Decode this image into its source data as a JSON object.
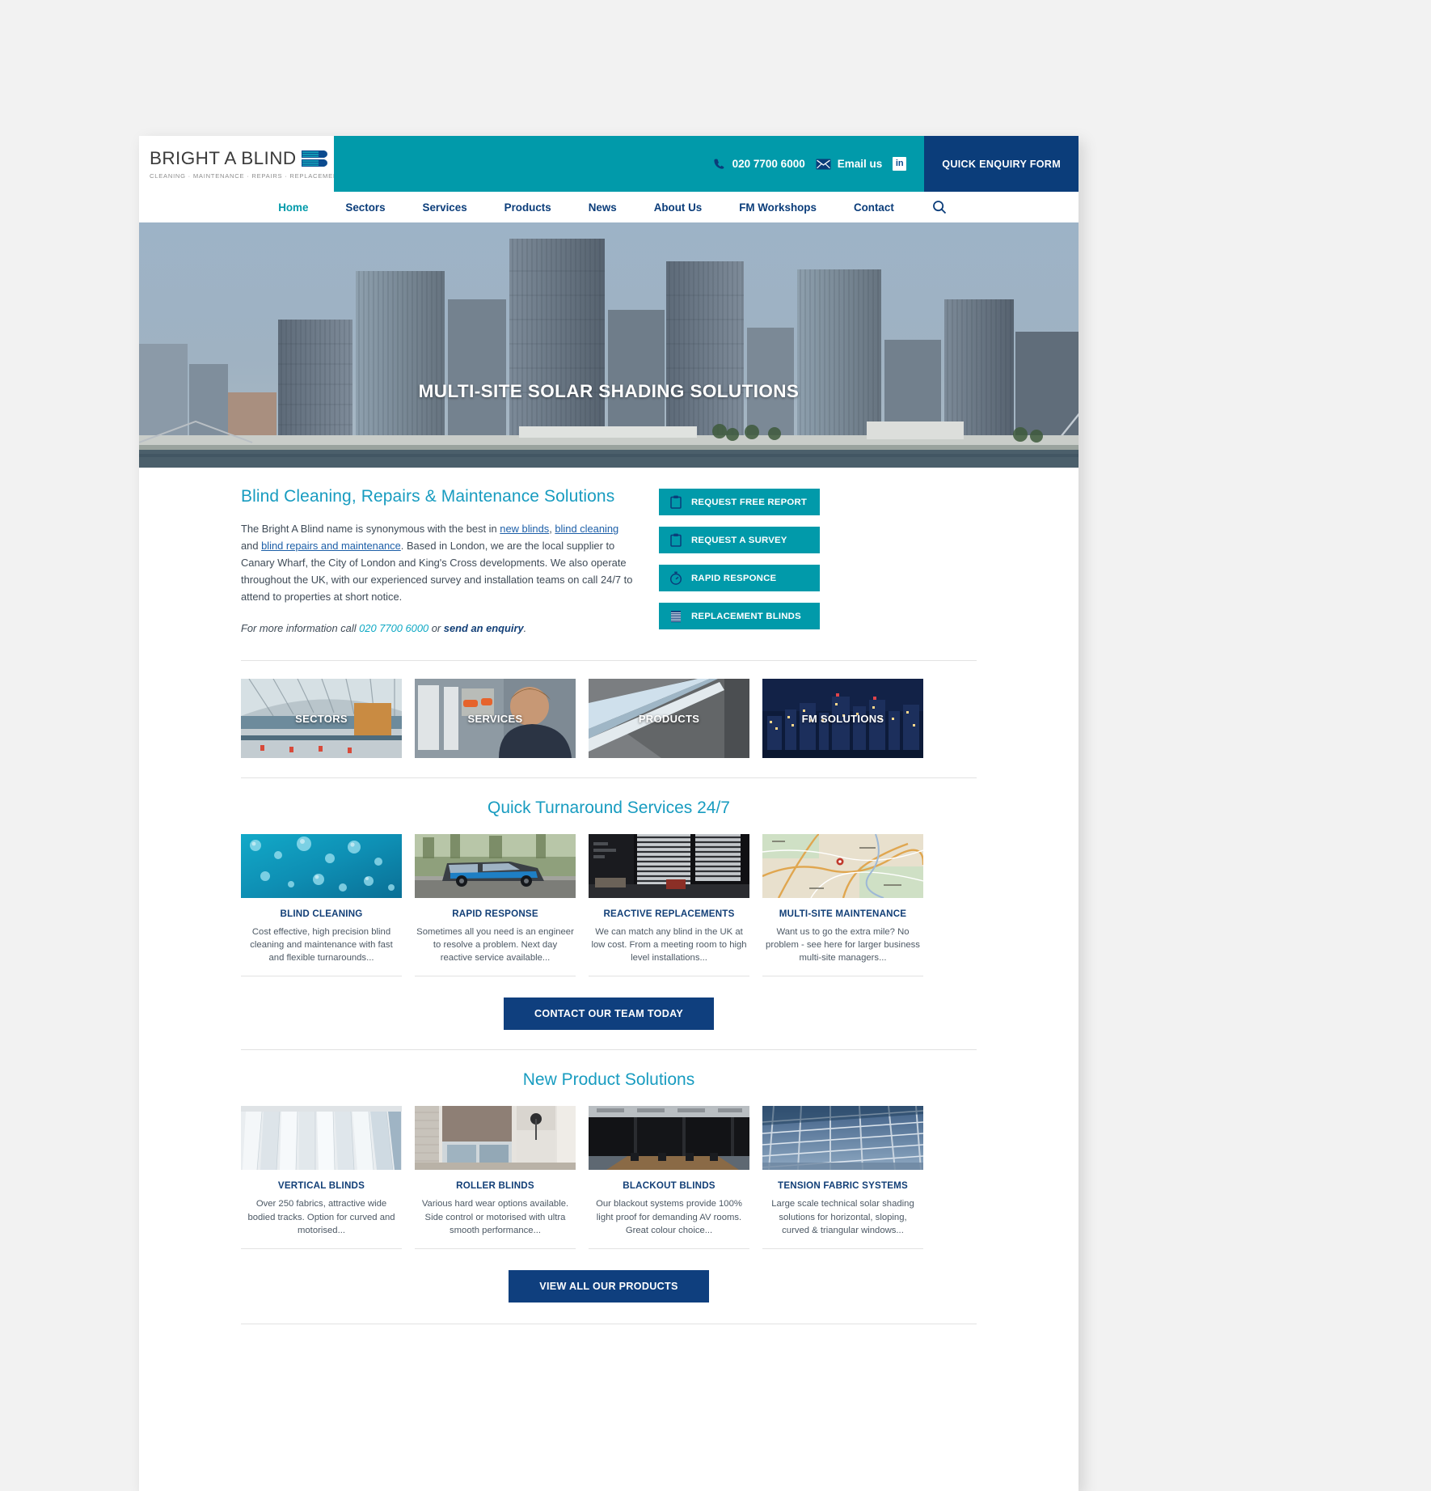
{
  "brand": {
    "name": "BRIGHT A BLIND",
    "tagline": "CLEANING · MAINTENANCE · REPAIRS · REPLACEMENTS",
    "teal": "#019aaa",
    "navy": "#0b3d7a",
    "heading_blue": "#189cc0"
  },
  "topbar": {
    "phone": "020 7700 6000",
    "email_label": "Email us",
    "linkedin_label": "in",
    "quick_enquiry": "QUICK ENQUIRY FORM"
  },
  "nav": {
    "items": [
      {
        "label": "Home",
        "active": true
      },
      {
        "label": "Sectors",
        "active": false
      },
      {
        "label": "Services",
        "active": false
      },
      {
        "label": "Products",
        "active": false
      },
      {
        "label": "News",
        "active": false
      },
      {
        "label": "About Us",
        "active": false
      },
      {
        "label": "FM Workshops",
        "active": false
      },
      {
        "label": "Contact",
        "active": false
      }
    ],
    "search_icon": "search-icon"
  },
  "hero": {
    "title": "MULTI-SITE SOLAR SHADING SOLUTIONS"
  },
  "intro": {
    "heading": "Blind Cleaning, Repairs & Maintenance Solutions",
    "paragraph_part1": "The Bright A Blind name is synonymous with the best in ",
    "link_new_blinds": "new blinds",
    "sep1": ", ",
    "link_blind_cleaning": "blind cleaning",
    "sep2": " and ",
    "link_repairs": "blind repairs and maintenance",
    "paragraph_part2": ". Based in London, we are the local supplier to Canary Wharf, the City of London and King's Cross developments. We also operate throughout the UK, with our experienced survey and installation teams on call 24/7 to attend to properties at short notice.",
    "note_prefix": "For more information call ",
    "note_phone": "020 7700 6000",
    "note_mid": " or ",
    "note_link": "send an enquiry",
    "note_suffix": "."
  },
  "cta_buttons": [
    {
      "label": "REQUEST FREE REPORT",
      "icon": "clipboard-icon"
    },
    {
      "label": "REQUEST A SURVEY",
      "icon": "clipboard-icon"
    },
    {
      "label": "RAPID RESPONCE",
      "icon": "stopwatch-icon"
    },
    {
      "label": "REPLACEMENT BLINDS",
      "icon": "blinds-icon"
    }
  ],
  "tiles": [
    {
      "label": "SECTORS",
      "image": "airport-terminal-photo"
    },
    {
      "label": "SERVICES",
      "image": "engineer-working-photo"
    },
    {
      "label": "PRODUCTS",
      "image": "roller-blind-fabric-photo"
    },
    {
      "label": "FM SOLUTIONS",
      "image": "city-skyline-night-photo"
    }
  ],
  "services_section": {
    "title": "Quick Turnaround Services 24/7",
    "cards": [
      {
        "title": "BLIND CLEANING",
        "desc": "Cost effective, high precision blind cleaning and maintenance with fast and flexible turnarounds...",
        "image": "water-droplets-blue-photo"
      },
      {
        "title": "RAPID RESPONSE",
        "desc": "Sometimes all you need is an engineer to resolve a problem. Next day reactive service available...",
        "image": "company-van-photo"
      },
      {
        "title": "REACTIVE REPLACEMENTS",
        "desc": "We can match any blind in the UK at low cost. From a meeting room to high level installations...",
        "image": "office-venetian-blinds-photo"
      },
      {
        "title": "MULTI-SITE MAINTENANCE",
        "desc": "Want us to go the extra mile? No problem - see here for larger business multi-site managers...",
        "image": "road-map-photo"
      }
    ],
    "button": "CONTACT OUR TEAM TODAY"
  },
  "products_section": {
    "title": "New Product Solutions",
    "cards": [
      {
        "title": "VERTICAL BLINDS",
        "desc": "Over 250 fabrics, attractive wide bodied tracks. Option for curved and motorised...",
        "image": "vertical-blinds-photo"
      },
      {
        "title": "ROLLER BLINDS",
        "desc": "Various hard wear options available. Side control or motorised with ultra smooth performance...",
        "image": "roller-blinds-room-photo"
      },
      {
        "title": "BLACKOUT BLINDS",
        "desc": "Our blackout systems provide 100% light proof for demanding AV rooms. Great colour choice...",
        "image": "blackout-boardroom-photo"
      },
      {
        "title": "TENSION FABRIC SYSTEMS",
        "desc": "Large scale technical solar shading solutions for horizontal, sloping, curved & triangular windows...",
        "image": "atrium-roof-photo"
      }
    ],
    "button": "VIEW ALL OUR PRODUCTS"
  }
}
